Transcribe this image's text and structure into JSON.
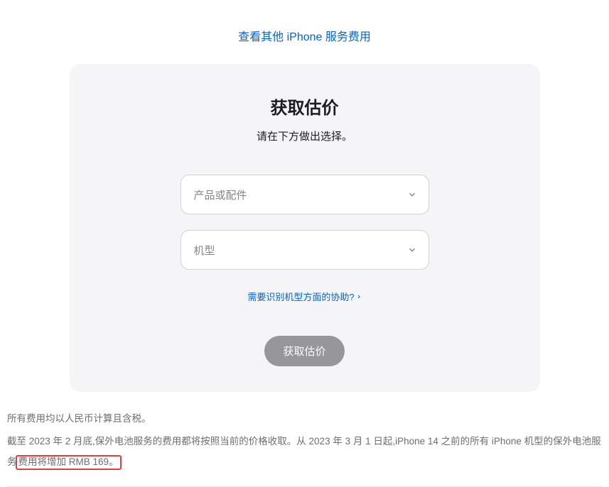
{
  "topLink": "查看其他 iPhone 服务费用",
  "card": {
    "title": "获取估价",
    "subtitle": "请在下方做出选择。",
    "select1": {
      "placeholder": "产品或配件"
    },
    "select2": {
      "placeholder": "机型"
    },
    "helpLink": "需要识别机型方面的协助?",
    "button": "获取估价"
  },
  "footer": {
    "line1": "所有费用均以人民币计算且含税。",
    "line2_a": "截至 2023 年 2 月底,保外电池服务的费用都将按照当前的价格收取。从 2023 年 3 月 1 日起,iPhone 14 之前的所有 iPhone 机型的保外电池服务",
    "line2_b": "费用将增加 RMB 169。"
  }
}
